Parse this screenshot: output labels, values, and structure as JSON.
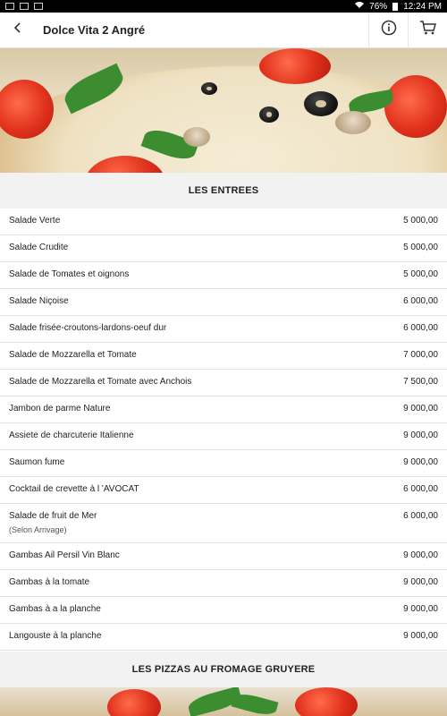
{
  "status_bar": {
    "battery": "76%",
    "time": "12:24 PM"
  },
  "app_bar": {
    "title": "Dolce Vita 2 Angré",
    "icons": [
      "back-arrow-icon",
      "info-icon",
      "cart-icon"
    ]
  },
  "sections": [
    {
      "title": "LES ENTREES",
      "items": [
        {
          "name": "Salade Verte",
          "price": "5 000,00"
        },
        {
          "name": "Salade Crudite",
          "price": "5 000,00"
        },
        {
          "name": "Salade de Tomates et oignons",
          "price": "5 000,00"
        },
        {
          "name": "Salade Niçoise",
          "price": "6 000,00"
        },
        {
          "name": "Salade frisée-croutons-lardons-oeuf dur",
          "price": "6 000,00"
        },
        {
          "name": "Salade de Mozzarella et Tomate",
          "price": "7 000,00"
        },
        {
          "name": "Salade de Mozzarella et Tomate avec Anchois",
          "price": "7 500,00"
        },
        {
          "name": "Jambon de parme Nature",
          "price": "9 000,00"
        },
        {
          "name": "Assiete de charcuterie Italienne",
          "price": "9 000,00"
        },
        {
          "name": "Saumon fume",
          "price": "9 000,00"
        },
        {
          "name": "Cocktail de crevette à l 'AVOCAT",
          "price": "6 000,00"
        },
        {
          "name": "Salade de fruit de Mer",
          "note": "(Selon Arrivage)",
          "price": "6 000,00"
        },
        {
          "name": "Gambas Ail Persil Vin Blanc",
          "price": "9 000,00"
        },
        {
          "name": "Gambas à la tomate",
          "price": "9 000,00"
        },
        {
          "name": "Gambas à a la planche",
          "price": "9 000,00"
        },
        {
          "name": "Langouste à la planche",
          "price": "9 000,00"
        }
      ]
    },
    {
      "title": "LES PIZZAS AU FROMAGE GRUYERE"
    }
  ]
}
